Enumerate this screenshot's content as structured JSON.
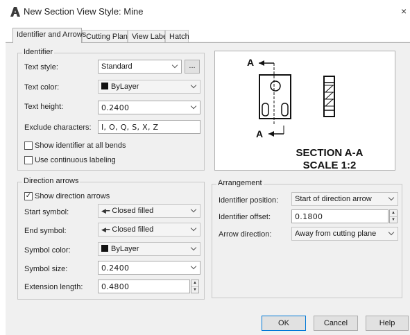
{
  "window": {
    "title": "New Section View Style: Mine",
    "app_icon": "autocad-a-icon",
    "close_label": "×"
  },
  "tabs": [
    {
      "label": "Identifier and Arrows",
      "active": true
    },
    {
      "label": "Cutting Plane",
      "active": false
    },
    {
      "label": "View Label",
      "active": false
    },
    {
      "label": "Hatch",
      "active": false
    }
  ],
  "identifier": {
    "group_title": "Identifier",
    "text_style": {
      "label": "Text style:",
      "value": "Standard",
      "browse_label": "..."
    },
    "text_color": {
      "label": "Text color:",
      "value": "ByLayer",
      "swatch": "#111111"
    },
    "text_height": {
      "label": "Text height:",
      "value": "0.2400"
    },
    "exclude_chars": {
      "label": "Exclude characters:",
      "value": "I, O, Q, S, X, Z"
    },
    "show_at_bends": {
      "label": "Show identifier at all bends",
      "checked": false
    },
    "continuous_labeling": {
      "label": "Use continuous labeling",
      "checked": false
    }
  },
  "direction_arrows": {
    "group_title": "Direction arrows",
    "show": {
      "label": "Show direction arrows",
      "checked": true,
      "mark": "✓"
    },
    "start_symbol": {
      "label": "Start symbol:",
      "value": "Closed filled"
    },
    "end_symbol": {
      "label": "End symbol:",
      "value": "Closed filled"
    },
    "symbol_color": {
      "label": "Symbol color:",
      "value": "ByLayer",
      "swatch": "#111111"
    },
    "symbol_size": {
      "label": "Symbol size:",
      "value": "0.2400"
    },
    "extension_length": {
      "label": "Extension length:",
      "value": "0.4800"
    }
  },
  "preview": {
    "label_top": "A",
    "label_bottom": "A",
    "caption_line1": "SECTION A-A",
    "caption_line2": "SCALE 1:2"
  },
  "arrangement": {
    "group_title": "Arrangement",
    "identifier_position": {
      "label": "Identifier position:",
      "value": "Start of direction arrow"
    },
    "identifier_offset": {
      "label": "Identifier offset:",
      "value": "0.1800"
    },
    "arrow_direction": {
      "label": "Arrow direction:",
      "value": "Away from cutting plane"
    }
  },
  "buttons": {
    "ok": "OK",
    "cancel": "Cancel",
    "help": "Help"
  }
}
